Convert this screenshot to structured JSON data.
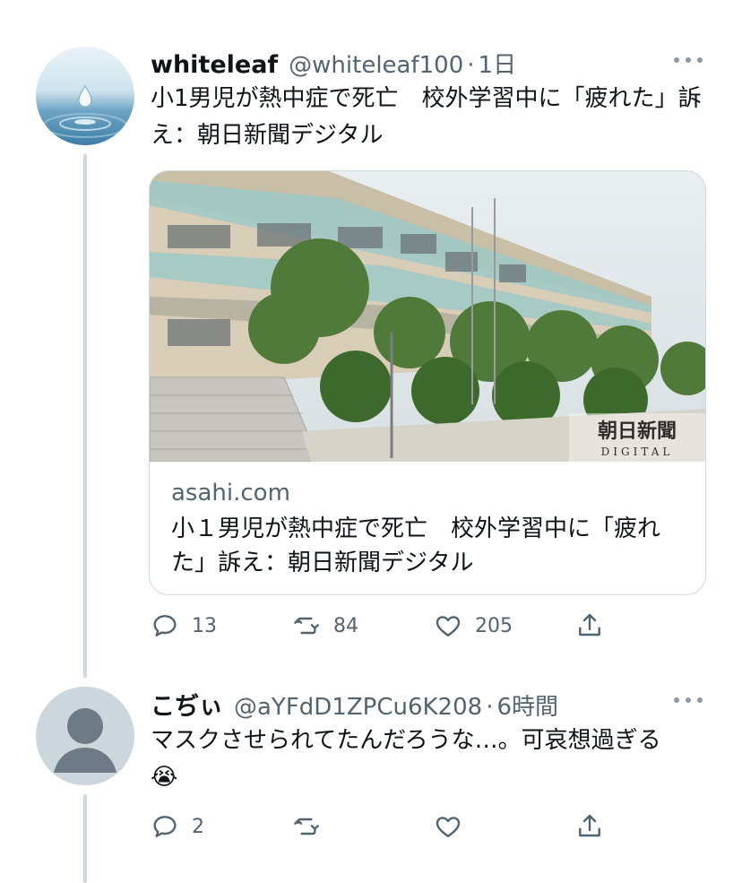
{
  "tweets": [
    {
      "name": "whiteleaf",
      "handle": "@whiteleaf100",
      "time": "1日",
      "text": "小1男児が熱中症で死亡　校外学習中に「疲れた」訴え：朝日新聞デジタル",
      "card": {
        "domain": "asahi.com",
        "title": "小１男児が熱中症で死亡　校外学習中に「疲れた」訴え：朝日新聞デジタル",
        "watermark_main": "朝日新聞",
        "watermark_sub": "DIGITAL"
      },
      "stats": {
        "replies": "13",
        "retweets": "84",
        "likes": "205"
      }
    },
    {
      "name": "こぢぃ",
      "handle": "@aYFdD1ZPCu6K208",
      "time": "6時間",
      "text": "マスクさせられてたんだろうな…。可哀想過ぎる😭",
      "stats": {
        "replies": "2",
        "retweets": "",
        "likes": ""
      }
    }
  ],
  "icons": {
    "reply": "reply-icon",
    "retweet": "retweet-icon",
    "like": "heart-icon",
    "share": "share-icon",
    "more": "more-icon"
  },
  "colors": {
    "secondary_text": "#536471",
    "thread_line": "#cfd9de",
    "border": "#cfd9de"
  }
}
